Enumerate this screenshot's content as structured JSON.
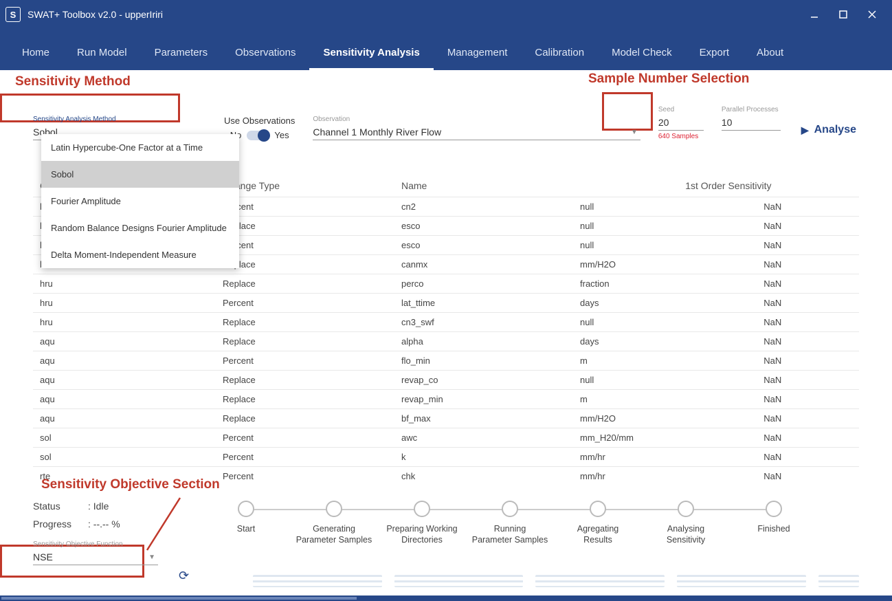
{
  "window": {
    "title": "SWAT+ Toolbox v2.0 - upperIriri",
    "logo_letter": "S"
  },
  "menu": {
    "items": [
      "Home",
      "Run Model",
      "Parameters",
      "Observations",
      "Sensitivity Analysis",
      "Management",
      "Calibration",
      "Model Check",
      "Export",
      "About"
    ],
    "active_index": 4
  },
  "annotations": {
    "method": "Sensitivity Method",
    "seed": "Sample Number Selection",
    "objective": "Sensitivity Objective Section"
  },
  "controls": {
    "method_label": "Sensitivity Analysis Method",
    "method_value": "Sobol",
    "use_obs_label": "Use Observations",
    "use_obs_no": "No",
    "use_obs_yes": "Yes",
    "obs_label": "Observation",
    "obs_value": "Channel 1 Monthly River Flow",
    "seed_label": "Seed",
    "seed_value": "20",
    "seed_hint": "640 Samples",
    "procs_label": "Parallel Processes",
    "procs_value": "10",
    "analyse": "Analyse"
  },
  "dropdown": {
    "items": [
      "Latin Hypercube-One Factor at a Time",
      "Sobol",
      "Fourier Amplitude",
      "Random Balance Designs Fourier Amplitude",
      "Delta Moment-Independent Measure"
    ],
    "selected_index": 1
  },
  "table": {
    "headers": [
      "Group",
      "Change Type",
      "Name",
      "",
      "1st Order Sensitivity"
    ],
    "rows": [
      {
        "g": "hru",
        "c": "Percent",
        "n": "cn2",
        "u": "null",
        "s": "NaN"
      },
      {
        "g": "hru",
        "c": "Replace",
        "n": "esco",
        "u": "null",
        "s": "NaN"
      },
      {
        "g": "hru",
        "c": "Percent",
        "n": "esco",
        "u": "null",
        "s": "NaN"
      },
      {
        "g": "hru",
        "c": "Replace",
        "n": "canmx",
        "u": "mm/H2O",
        "s": "NaN"
      },
      {
        "g": "hru",
        "c": "Replace",
        "n": "perco",
        "u": "fraction",
        "s": "NaN"
      },
      {
        "g": "hru",
        "c": "Percent",
        "n": "lat_ttime",
        "u": "days",
        "s": "NaN"
      },
      {
        "g": "hru",
        "c": "Replace",
        "n": "cn3_swf",
        "u": "null",
        "s": "NaN"
      },
      {
        "g": "aqu",
        "c": "Replace",
        "n": "alpha",
        "u": "days",
        "s": "NaN"
      },
      {
        "g": "aqu",
        "c": "Percent",
        "n": "flo_min",
        "u": "m",
        "s": "NaN"
      },
      {
        "g": "aqu",
        "c": "Replace",
        "n": "revap_co",
        "u": "null",
        "s": "NaN"
      },
      {
        "g": "aqu",
        "c": "Replace",
        "n": "revap_min",
        "u": "m",
        "s": "NaN"
      },
      {
        "g": "aqu",
        "c": "Replace",
        "n": "bf_max",
        "u": "mm/H2O",
        "s": "NaN"
      },
      {
        "g": "sol",
        "c": "Percent",
        "n": "awc",
        "u": "mm_H20/mm",
        "s": "NaN"
      },
      {
        "g": "sol",
        "c": "Percent",
        "n": "k",
        "u": "mm/hr",
        "s": "NaN"
      },
      {
        "g": "rte",
        "c": "Percent",
        "n": "chk",
        "u": "mm/hr",
        "s": "NaN"
      }
    ]
  },
  "status": {
    "status_lab": "Status",
    "status_val": ": Idle",
    "progress_lab": "Progress",
    "progress_val": ": --.-- %",
    "obj_label": "Sensitivity Objective Function",
    "obj_value": "NSE"
  },
  "steps": [
    "Start",
    "Generating\nParameter Samples",
    "Preparing Working\nDirectories",
    "Running\nParameter Samples",
    "Agregating\nResults",
    "Analysing\nSensitivity",
    "Finished"
  ]
}
